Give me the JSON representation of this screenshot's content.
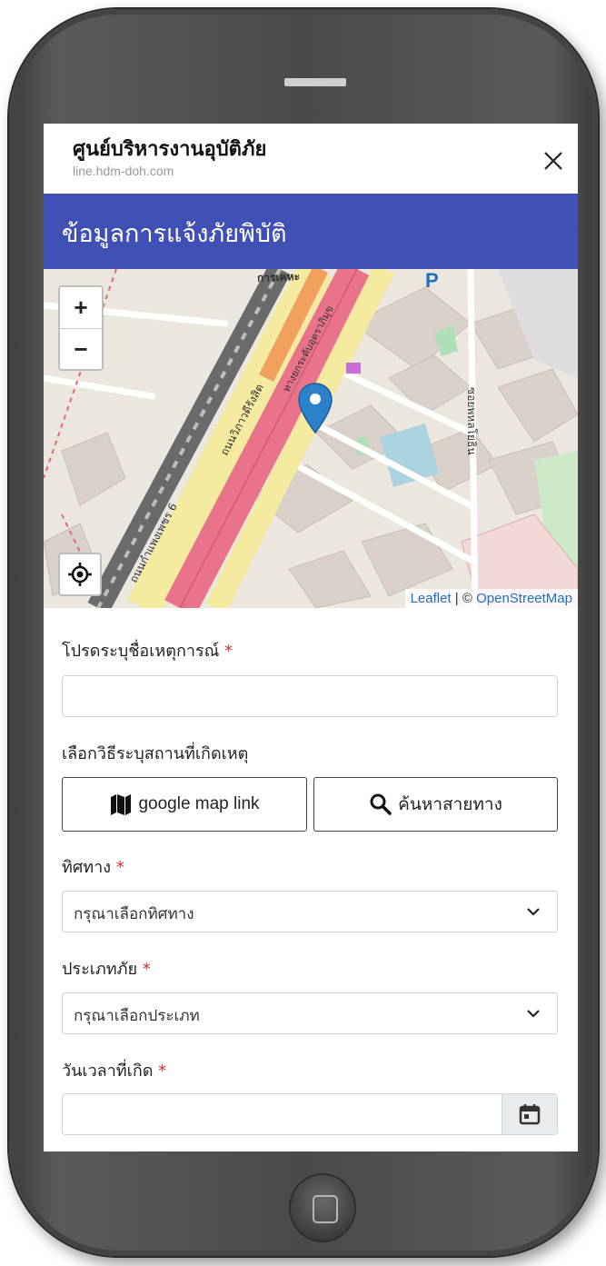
{
  "app": {
    "title": "ศูนย์บริหารงานอุบัติภัย",
    "url": "line.hdm-doh.com"
  },
  "header": {
    "title": "ข้อมูลการแจ้งภัยพิบัติ"
  },
  "map": {
    "zoom_in": "+",
    "zoom_out": "−",
    "attribution_leaflet": "Leaflet",
    "attribution_sep": " | © ",
    "attribution_osm": "OpenStreetMap",
    "road_labels": [
      "ถนนวิภาวดีรังสิต",
      "ถนนกำแพงเพชร 6",
      "ทางยกระดับอุตราภิมุข",
      "การเคหะ",
      "ซอยพหลโยธิน"
    ]
  },
  "form": {
    "incident_name": {
      "label": "โปรดระบุชื่อเหตุการณ์",
      "required_mark": "*",
      "value": ""
    },
    "location_method": {
      "label": "เลือกวิธีระบุสถานที่เกิดเหตุ",
      "google_button": "google map link",
      "search_button": "ค้นหาสายทาง"
    },
    "direction": {
      "label": "ทิศทาง",
      "required_mark": "*",
      "selected": "กรุณาเลือกทิศทาง"
    },
    "disaster_type": {
      "label": "ประเภทภัย",
      "required_mark": "*",
      "selected": "กรุณาเลือกประเภท"
    },
    "datetime": {
      "label": "วันเวลาที่เกิด",
      "required_mark": "*",
      "value": ""
    }
  },
  "colors": {
    "header_bg": "#4050b5",
    "required": "#d92f2f",
    "marker": "#2b82cb"
  }
}
